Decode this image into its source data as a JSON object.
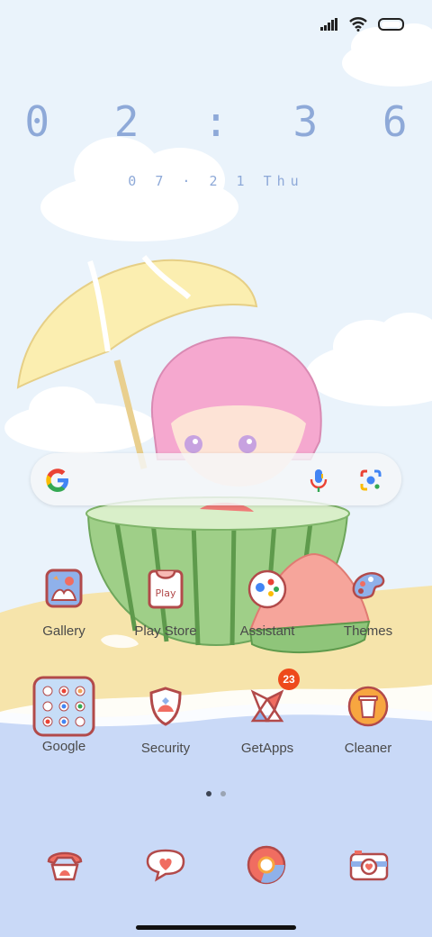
{
  "clock": {
    "time": "0 2 : 3 6",
    "date": "0 7 · 2 1  Thu"
  },
  "status_bar": {
    "icons": [
      "signal-icon",
      "wifi-icon",
      "battery-icon"
    ]
  },
  "search_bar": {
    "icons": [
      "google-logo-icon",
      "microphone-icon",
      "google-lens-icon"
    ]
  },
  "apps_row1": [
    {
      "label": "Gallery",
      "icon": "gallery-icon"
    },
    {
      "label": "Play Store",
      "icon": "play-store-icon",
      "icon_text": "Play"
    },
    {
      "label": "Assistant",
      "icon": "assistant-icon"
    },
    {
      "label": "Themes",
      "icon": "palette-icon"
    }
  ],
  "apps_row2": [
    {
      "label": "Google",
      "icon": "google-folder-icon"
    },
    {
      "label": "Security",
      "icon": "security-shield-icon"
    },
    {
      "label": "GetApps",
      "icon": "getapps-icon",
      "badge": "23"
    },
    {
      "label": "Cleaner",
      "icon": "cleaner-icon"
    }
  ],
  "page_indicator": {
    "pages": 2,
    "active": 1
  },
  "dock": [
    {
      "icon": "phone-icon"
    },
    {
      "icon": "messages-icon"
    },
    {
      "icon": "browser-icon"
    },
    {
      "icon": "camera-icon"
    }
  ],
  "colors": {
    "clock": "#8ea9d8",
    "badge": "#ee4a1b",
    "sky": "#eaf3fb",
    "sea": "#c9d9f7",
    "sand": "#f6e4ab"
  }
}
